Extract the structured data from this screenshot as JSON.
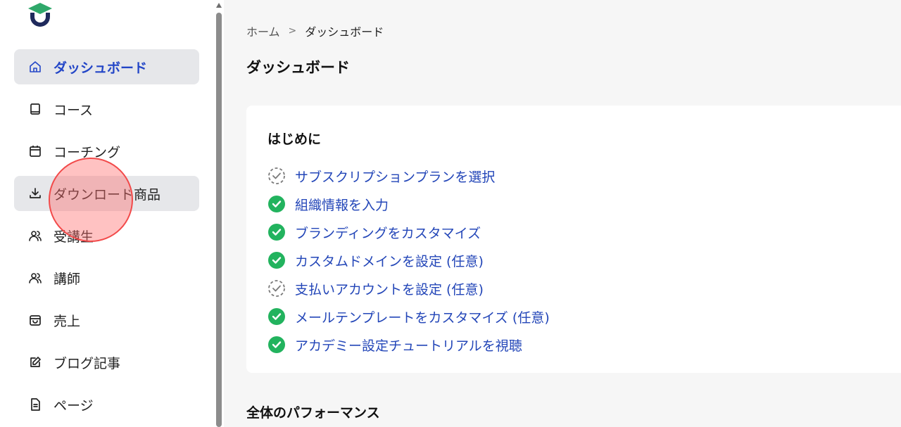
{
  "sidebar": {
    "logo_icon": "academy-logo-icon",
    "items": [
      {
        "label": "ダッシュボード",
        "icon": "home-icon",
        "state": "active"
      },
      {
        "label": "コース",
        "icon": "book-icon",
        "state": "normal"
      },
      {
        "label": "コーチング",
        "icon": "calendar-icon",
        "state": "normal"
      },
      {
        "label": "ダウンロード商品",
        "icon": "download-icon",
        "state": "hover"
      },
      {
        "label": "受講生",
        "icon": "users-icon",
        "state": "normal"
      },
      {
        "label": "講師",
        "icon": "users-icon",
        "state": "normal"
      },
      {
        "label": "売上",
        "icon": "shopping-bag-icon",
        "state": "normal"
      },
      {
        "label": "ブログ記事",
        "icon": "edit-icon",
        "state": "normal"
      },
      {
        "label": "ページ",
        "icon": "document-icon",
        "state": "normal"
      }
    ]
  },
  "breadcrumb": {
    "home": "ホーム",
    "separator": ">",
    "current": "ダッシュボード"
  },
  "page_title": "ダッシュボード",
  "getting_started": {
    "title": "はじめに",
    "items": [
      {
        "label": "サブスクリプションプランを選択",
        "done": false
      },
      {
        "label": "組織情報を入力",
        "done": true
      },
      {
        "label": "ブランディングをカスタマイズ",
        "done": true
      },
      {
        "label": "カスタムドメインを設定 (任意)",
        "done": true
      },
      {
        "label": "支払いアカウントを設定 (任意)",
        "done": false
      },
      {
        "label": "メールテンプレートをカスタマイズ (任意)",
        "done": true
      },
      {
        "label": "アカデミー設定チュートリアルを視聴",
        "done": true
      }
    ]
  },
  "performance": {
    "title": "全体のパフォーマンス"
  },
  "colors": {
    "accent": "#2346c7",
    "link": "#2346b8",
    "done": "#22b35e",
    "pending": "#7a7a7a",
    "logo_green": "#2fa86a",
    "logo_navy": "#1f2a5c"
  }
}
